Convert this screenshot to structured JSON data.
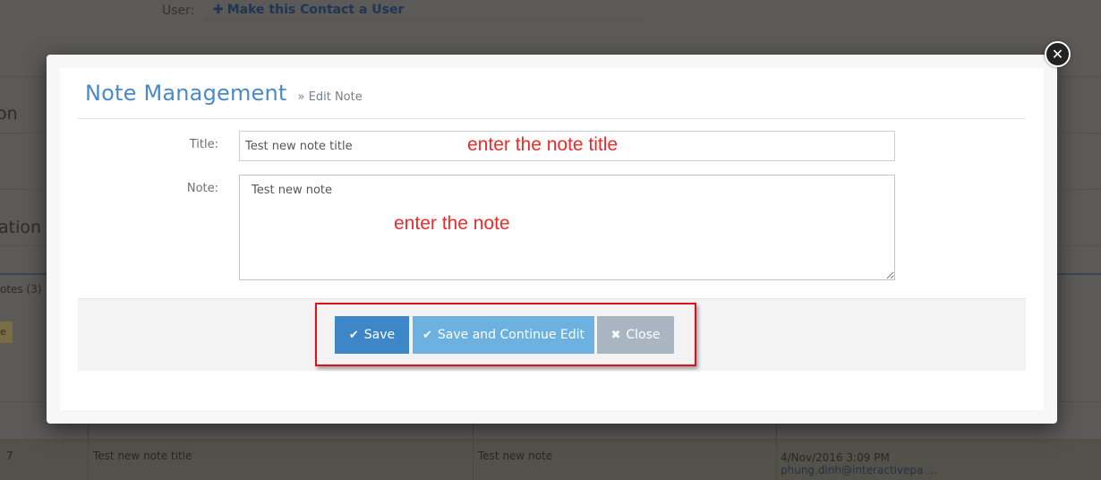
{
  "background": {
    "user_label": "User:",
    "make_user_link": "Make this Contact a User",
    "make_user_icon": "plus-icon",
    "section1_fragment": "on",
    "section2_fragment": "ation",
    "notes_tab": "otes (3)",
    "badge_fragment": "e",
    "table_row": {
      "id": "7",
      "title": "Test new note title",
      "note": "Test new note",
      "date": "4/Nov/2016 3:09 PM",
      "author": "phung.dinh@interactivepa ..."
    }
  },
  "modal": {
    "title": "Note Management",
    "breadcrumb": "» Edit Note",
    "close_icon": "close-icon",
    "fields": {
      "title_label": "Title:",
      "title_value": "Test new note title",
      "note_label": "Note:",
      "note_value": "Test new note"
    },
    "buttons": {
      "save": "Save",
      "save_continue": "Save and Continue Edit",
      "close": "Close"
    }
  },
  "annotations": {
    "title_hint": "enter the note title",
    "note_hint": "enter the note",
    "color": "#ee2a2a"
  },
  "colors": {
    "accent": "#3d87c9",
    "secondary": "#6cb1e0",
    "muted": "#a9b5c0",
    "title": "#4a8ac6"
  }
}
